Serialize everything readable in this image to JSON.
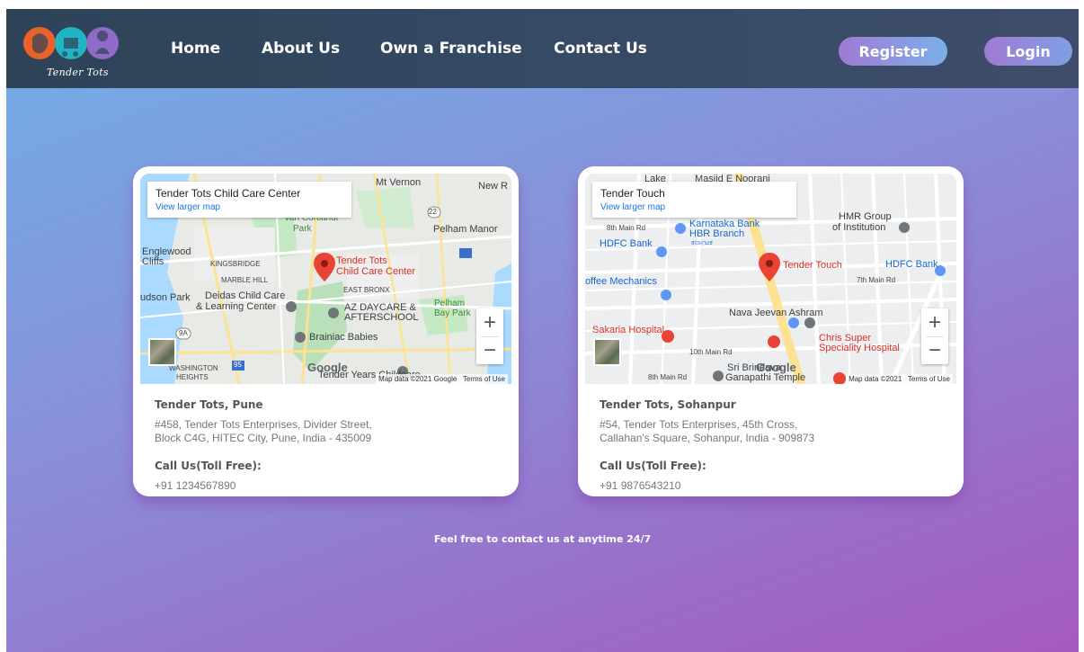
{
  "header": {
    "logo_text": "Tender Tots",
    "nav": [
      {
        "label": "Home"
      },
      {
        "label": "About Us"
      },
      {
        "label": "Own a Franchise"
      },
      {
        "label": "Contact Us"
      }
    ],
    "register_label": "Register",
    "login_label": "Login",
    "colors": {
      "header_bg": "#354a63",
      "button_from": "#a07ad3",
      "button_to": "#7bb0e8"
    }
  },
  "cards": [
    {
      "map": {
        "place_title": "Tender Tots Child Care Center",
        "view_larger": "View larger map",
        "pin_label_1": "Tender Tots",
        "pin_label_2": "Child Care Center",
        "labels": {
          "mt_vernon": "Mt Vernon",
          "new_r": "New R",
          "van_cortlandt": "Van Cortlandt",
          "park": "Park",
          "englewood": "Englewood",
          "cliffs": "Cliffs",
          "kingsbridge": "KINGSBRIDGE",
          "marble_hill": "MARBLE HILL",
          "pelham_manor": "Pelham Manor",
          "udson_park": "udson Park",
          "deidas_1": "Deidas Child Care",
          "deidas_2": "& Learning Center",
          "east_bronx": "EAST BRONX",
          "az_1": "AZ DAYCARE &",
          "az_2": "AFTERSCHOOL",
          "pelham_bay_1": "Pelham",
          "pelham_bay_2": "Bay Park",
          "brainiac": "Brainiac Babies",
          "washington": "WASHINGTON",
          "heights": "HEIGHTS",
          "tender_years": "Tender Years Childcare",
          "road_9a": "9A",
          "road_95": "95",
          "road_22": "22"
        },
        "attribution": "Map data ©2021 Google",
        "terms": "Terms of Use",
        "google": "Google"
      },
      "title": "Tender Tots, Pune",
      "address": "#458, Tender Tots Enterprises, Divider Street, Block C4G, HITEC City, Pune, India - 435009",
      "phone_label": "Call Us(Toll Free):",
      "phone": "+91 1234567890"
    },
    {
      "map": {
        "place_title": "Tender Touch",
        "view_larger": "View larger map",
        "pin_label_1": "Tender Touch",
        "labels": {
          "lake": "Lake",
          "masjid": "Masjid E Noorani",
          "main_rd_8th": "8th Main Rd",
          "karnataka_1": "Karnataka Bank",
          "karnataka_2": "HBR Branch",
          "karnataka_kn": "ಕರ್ನಾಟಕ",
          "hmr_1": "HMR Group",
          "hmr_2": "of Institution",
          "hdfc_left": "HDFC Bank",
          "hdfc_right": "HDFC Bank",
          "offee": "offee Mechanics",
          "main_rd_7th": "7th Main Rd",
          "nava": "Nava Jeevan Ashram",
          "sakaria": "Sakaria Hospital",
          "chris_1": "Chris Super",
          "chris_2": "Speciality Hospital",
          "main_rd_10th": "10th Main Rd",
          "sri_1": "Sri Brindava",
          "sri_2": "Ganapathi Temple",
          "main_rd_8th_b": "8th Main Rd"
        },
        "attribution": "Map data ©2021",
        "terms": "Terms of Use",
        "google": "Google"
      },
      "title": "Tender Tots, Sohanpur",
      "address": "#54, Tender Tots Enterprises, 45th Cross, Callahan's Square, Sohanpur, India - 909873",
      "phone_label": "Call Us(Toll Free):",
      "phone": "+91 9876543210"
    }
  ],
  "footer": {
    "text": "Feel free to contact us at anytime 24/7"
  },
  "icons": {
    "zoom_in": "+",
    "zoom_out": "−"
  }
}
